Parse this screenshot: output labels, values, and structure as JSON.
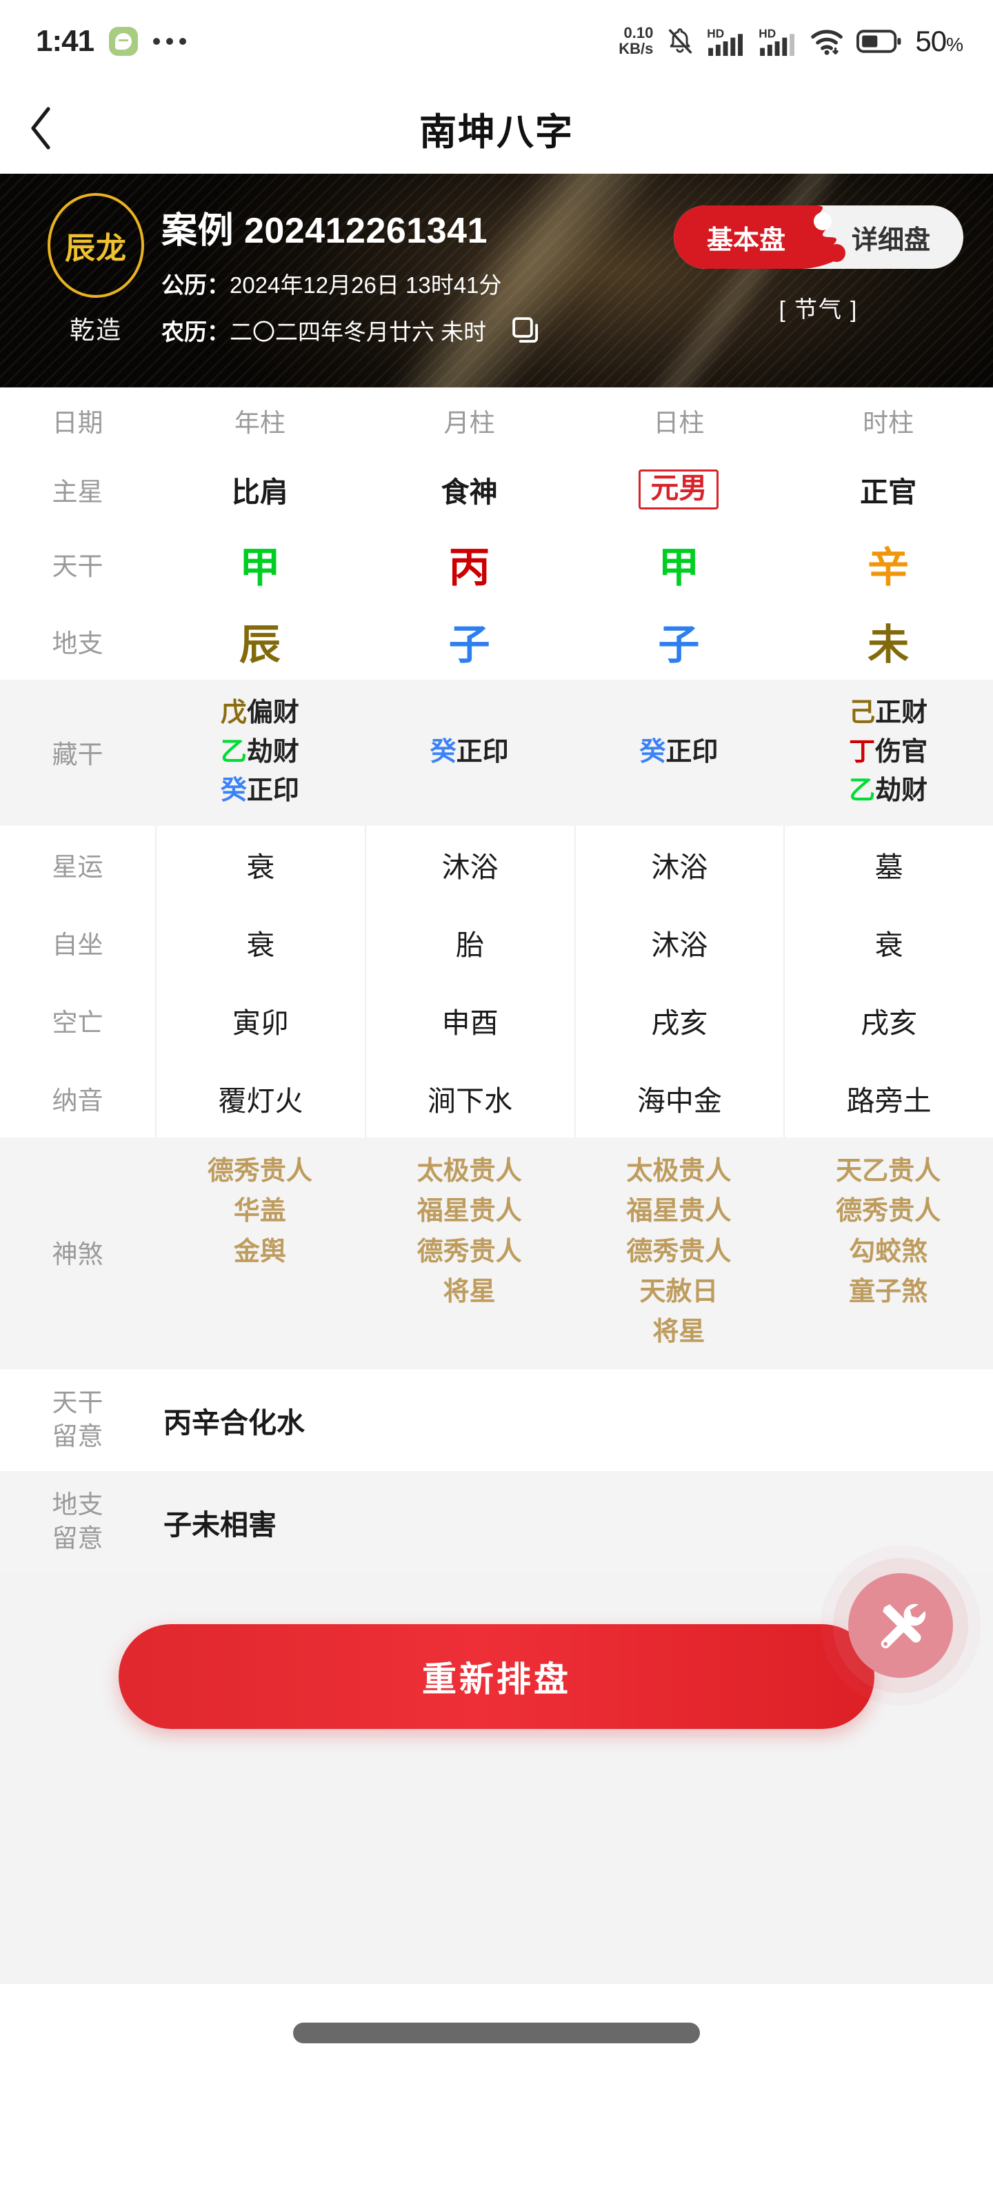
{
  "statusbar": {
    "time": "1:41",
    "app_icon": "chat-bubble-icon",
    "more_icon": "more-dots-icon",
    "net_speed_value": "0.10",
    "net_speed_unit": "KB/s",
    "mute_icon": "bell-muted-icon",
    "signal1_label": "HD",
    "signal2_label": "HD",
    "wifi_icon": "wifi-icon",
    "battery_icon": "battery-icon",
    "battery_percent": "50",
    "battery_unit": "%"
  },
  "navbar": {
    "back_icon": "chevron-left-icon",
    "title": "南坤八字"
  },
  "hero": {
    "zodiac_badge": "辰龙",
    "gender_label": "乾造",
    "case_title": "案例 202412261341",
    "solar_key": "公历：",
    "solar_value": "2024年12月26日 13时41分",
    "lunar_key": "农历：",
    "lunar_value": "二〇二四年冬月廿六 未时",
    "copy_icon": "copy-icon",
    "segment": {
      "active": "基本盘",
      "inactive": "详细盘",
      "active_index": 0
    },
    "jieqi_label": "[ 节气 ]",
    "accent_gold": "#E9B322",
    "accent_red": "#D71921"
  },
  "table": {
    "row_labels": {
      "date": "日期",
      "main_star": "主星",
      "heavenly_stem": "天干",
      "earthly_branch": "地支",
      "hidden_stems": "藏干",
      "star_fortune": "星运",
      "self_sit": "自坐",
      "void": "空亡",
      "nayin": "纳音",
      "shensha": "神煞"
    },
    "columns": [
      "年柱",
      "月柱",
      "日柱",
      "时柱"
    ],
    "main_star": [
      {
        "text": "比肩",
        "highlight": false
      },
      {
        "text": "食神",
        "highlight": false
      },
      {
        "text": "元男",
        "highlight": true
      },
      {
        "text": "正官",
        "highlight": false
      }
    ],
    "heavenly_stem": [
      {
        "text": "甲",
        "color": "#00CE22"
      },
      {
        "text": "丙",
        "color": "#CC0000"
      },
      {
        "text": "甲",
        "color": "#00CE22"
      },
      {
        "text": "辛",
        "color": "#F0960A"
      }
    ],
    "earthly_branch": [
      {
        "text": "辰",
        "color": "#826A0C"
      },
      {
        "text": "子",
        "color": "#2E7FEE"
      },
      {
        "text": "子",
        "color": "#2E7FEE"
      },
      {
        "text": "未",
        "color": "#826A0C"
      }
    ],
    "hidden_stems": [
      [
        {
          "stem": "戊",
          "color": "#8B6D0F",
          "god": "偏财"
        },
        {
          "stem": "乙",
          "color": "#00DD33",
          "god": "劫财"
        },
        {
          "stem": "癸",
          "color": "#3B82F6",
          "god": "正印"
        }
      ],
      [
        {
          "stem": "癸",
          "color": "#3B82F6",
          "god": "正印"
        }
      ],
      [
        {
          "stem": "癸",
          "color": "#3B82F6",
          "god": "正印"
        }
      ],
      [
        {
          "stem": "己",
          "color": "#8B6D0F",
          "god": "正财"
        },
        {
          "stem": "丁",
          "color": "#CC0000",
          "god": "伤官"
        },
        {
          "stem": "乙",
          "color": "#00DD33",
          "god": "劫财"
        }
      ]
    ],
    "star_fortune": [
      "衰",
      "沐浴",
      "沐浴",
      "墓"
    ],
    "self_sit": [
      "衰",
      "胎",
      "沐浴",
      "衰"
    ],
    "void": [
      "寅卯",
      "申酉",
      "戌亥",
      "戌亥"
    ],
    "nayin": [
      "覆灯火",
      "涧下水",
      "海中金",
      "路旁土"
    ],
    "shensha": [
      [
        "德秀贵人",
        "华盖",
        "金舆"
      ],
      [
        "太极贵人",
        "福星贵人",
        "德秀贵人",
        "将星"
      ],
      [
        "太极贵人",
        "福星贵人",
        "德秀贵人",
        "天赦日",
        "将星"
      ],
      [
        "天乙贵人",
        "德秀贵人",
        "勾蛟煞",
        "童子煞"
      ]
    ],
    "shensha_color": "#BE9C5E"
  },
  "notes": [
    {
      "label": "天干\n留意",
      "label_line1": "天干",
      "label_line2": "留意",
      "value": "丙辛合化水"
    },
    {
      "label": "地支\n留意",
      "label_line1": "地支",
      "label_line2": "留意",
      "value": "子未相害"
    }
  ],
  "footer": {
    "rebuild_label": "重新排盘",
    "fab_icon": "tools-icon",
    "fab_color": "#E38C96",
    "home_indicator": "home-indicator"
  }
}
